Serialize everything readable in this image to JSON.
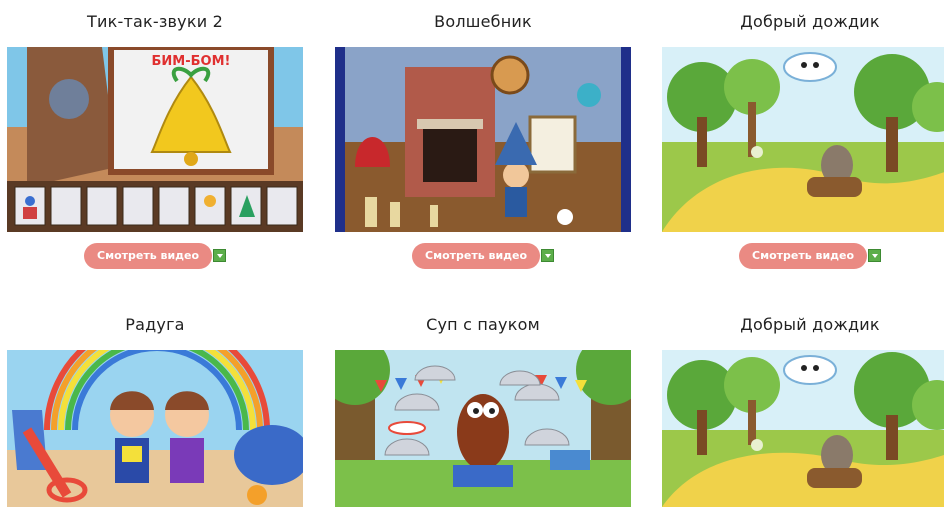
{
  "videos": [
    {
      "title": "Тик-так-звуки 2",
      "button": "Смотреть видео",
      "sign_text": "БИМ-БОМ!",
      "download_icon": "download-icon"
    },
    {
      "title": "Волшебник",
      "button": "Смотреть видео",
      "download_icon": "download-icon"
    },
    {
      "title": "Добрый дождик",
      "button": "Смотреть видео",
      "download_icon": "download-icon"
    },
    {
      "title": "Радуга"
    },
    {
      "title": "Суп с пауком"
    },
    {
      "title": "Добрый дождик"
    }
  ],
  "colors": {
    "button_bg": "#ea8a83",
    "button_text": "#ffffff",
    "download_icon": "#5cae4a",
    "title_text": "#222222"
  }
}
